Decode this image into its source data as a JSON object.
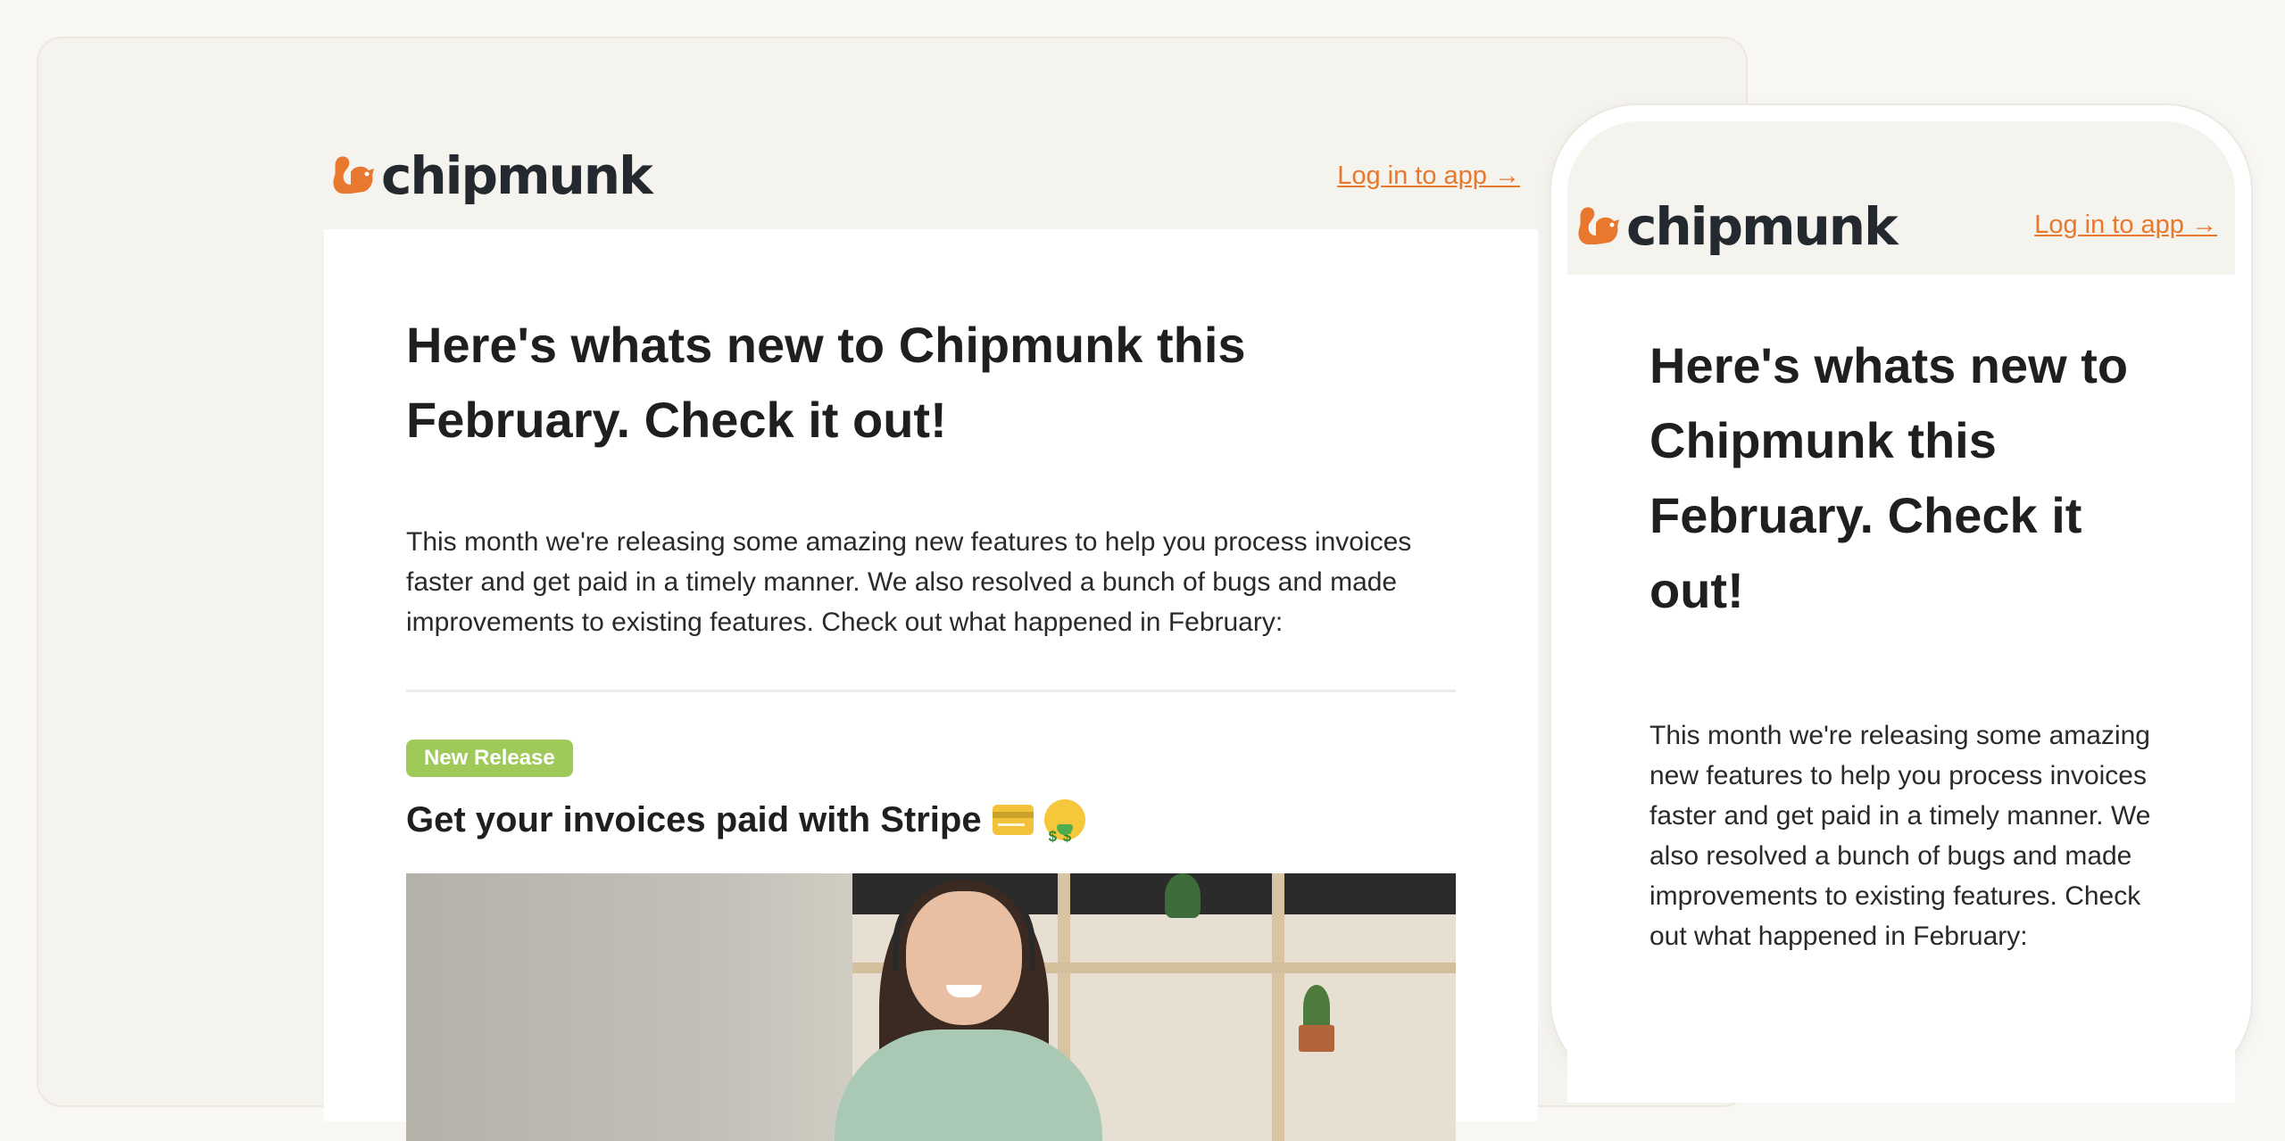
{
  "brand": {
    "name": "chipmunk",
    "accent_color": "#e8782e",
    "logo_text_color": "#24282f",
    "badge_color": "#9fca5a"
  },
  "header": {
    "login_link": "Log in to app →"
  },
  "email": {
    "title": "Here's whats new to Chipmunk this February. Check it out!",
    "intro": "This month we're releasing some amazing new features to help you process invoices faster and get paid in a timely manner. We also resolved a bunch of bugs and made improvements to existing features. Check out what happened in February:",
    "feature": {
      "badge": "New Release",
      "title": "Get your invoices paid with Stripe",
      "emoji_icons": [
        "credit-card-icon",
        "money-mouth-face-icon"
      ]
    }
  },
  "mobile": {
    "login_link": "Log in to app →",
    "title": "Here's whats new to Chipmunk this February. Check it out!",
    "intro": "This month we're releasing some amazing new features to help you process invoices faster and get paid in a timely manner. We also resolved a bunch of bugs and made improvements to existing features. Check out what happened in February:"
  }
}
